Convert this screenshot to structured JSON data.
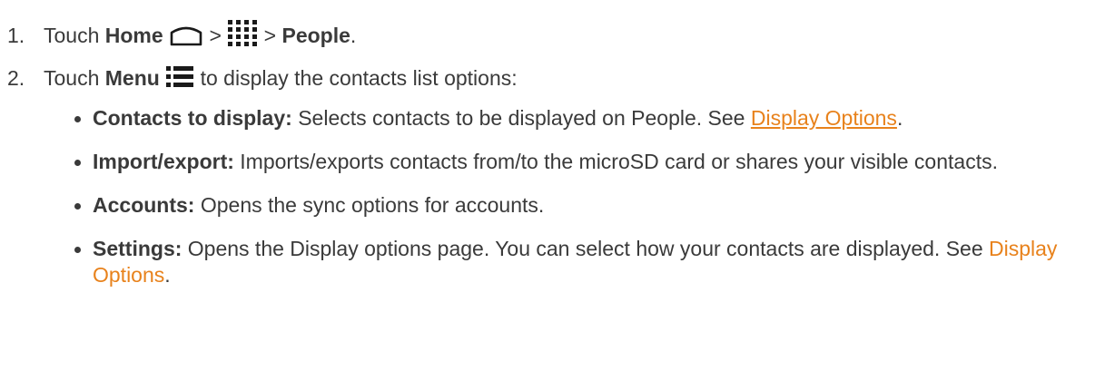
{
  "steps": [
    {
      "number": "1.",
      "text_before": "Touch ",
      "home_label": "Home",
      "sep1": " > ",
      "sep2": " > ",
      "people_label": "People",
      "end": ".",
      "icons": [
        "home-icon",
        "apps-grid-icon"
      ]
    },
    {
      "number": "2.",
      "text_before": "Touch ",
      "menu_label": "Menu",
      "text_after": " to display the contacts list options:",
      "icons": [
        "menu-icon"
      ]
    }
  ],
  "options": [
    {
      "term": "Contacts to display:",
      "desc": " Selects contacts to be displayed on People. See ",
      "link": "Display Options",
      "end": "."
    },
    {
      "term": "Import/export:",
      "desc": " Imports/exports contacts from/to the microSD card or shares your visible contacts."
    },
    {
      "term": "Accounts:",
      "desc": " Opens the sync options for accounts."
    },
    {
      "term": "Settings:",
      "desc": " Opens the Display options page. You can select how your contacts are displayed. See ",
      "link": "Display Options",
      "end": "."
    }
  ],
  "colors": {
    "text": "#3a3a3a",
    "link": "#e8821c"
  }
}
